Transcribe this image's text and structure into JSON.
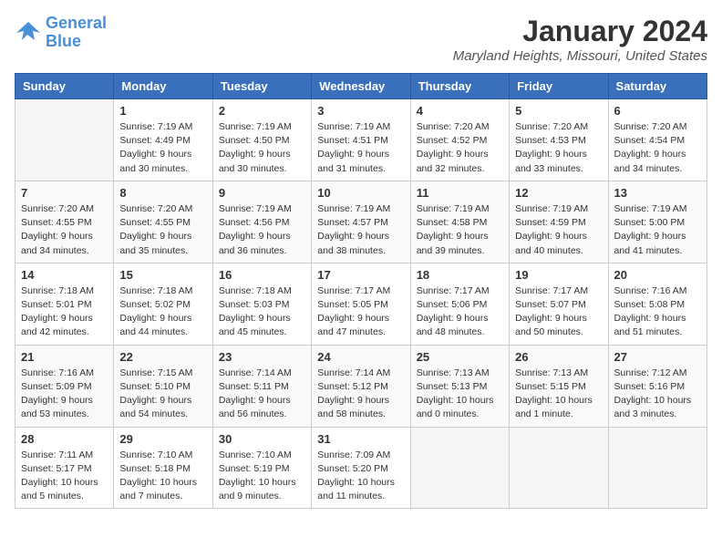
{
  "logo": {
    "line1": "General",
    "line2": "Blue"
  },
  "title": "January 2024",
  "location": "Maryland Heights, Missouri, United States",
  "headers": [
    "Sunday",
    "Monday",
    "Tuesday",
    "Wednesday",
    "Thursday",
    "Friday",
    "Saturday"
  ],
  "weeks": [
    [
      {
        "day": "",
        "info": ""
      },
      {
        "day": "1",
        "info": "Sunrise: 7:19 AM\nSunset: 4:49 PM\nDaylight: 9 hours\nand 30 minutes."
      },
      {
        "day": "2",
        "info": "Sunrise: 7:19 AM\nSunset: 4:50 PM\nDaylight: 9 hours\nand 30 minutes."
      },
      {
        "day": "3",
        "info": "Sunrise: 7:19 AM\nSunset: 4:51 PM\nDaylight: 9 hours\nand 31 minutes."
      },
      {
        "day": "4",
        "info": "Sunrise: 7:20 AM\nSunset: 4:52 PM\nDaylight: 9 hours\nand 32 minutes."
      },
      {
        "day": "5",
        "info": "Sunrise: 7:20 AM\nSunset: 4:53 PM\nDaylight: 9 hours\nand 33 minutes."
      },
      {
        "day": "6",
        "info": "Sunrise: 7:20 AM\nSunset: 4:54 PM\nDaylight: 9 hours\nand 34 minutes."
      }
    ],
    [
      {
        "day": "7",
        "info": "Sunrise: 7:20 AM\nSunset: 4:55 PM\nDaylight: 9 hours\nand 34 minutes."
      },
      {
        "day": "8",
        "info": "Sunrise: 7:20 AM\nSunset: 4:55 PM\nDaylight: 9 hours\nand 35 minutes."
      },
      {
        "day": "9",
        "info": "Sunrise: 7:19 AM\nSunset: 4:56 PM\nDaylight: 9 hours\nand 36 minutes."
      },
      {
        "day": "10",
        "info": "Sunrise: 7:19 AM\nSunset: 4:57 PM\nDaylight: 9 hours\nand 38 minutes."
      },
      {
        "day": "11",
        "info": "Sunrise: 7:19 AM\nSunset: 4:58 PM\nDaylight: 9 hours\nand 39 minutes."
      },
      {
        "day": "12",
        "info": "Sunrise: 7:19 AM\nSunset: 4:59 PM\nDaylight: 9 hours\nand 40 minutes."
      },
      {
        "day": "13",
        "info": "Sunrise: 7:19 AM\nSunset: 5:00 PM\nDaylight: 9 hours\nand 41 minutes."
      }
    ],
    [
      {
        "day": "14",
        "info": "Sunrise: 7:18 AM\nSunset: 5:01 PM\nDaylight: 9 hours\nand 42 minutes."
      },
      {
        "day": "15",
        "info": "Sunrise: 7:18 AM\nSunset: 5:02 PM\nDaylight: 9 hours\nand 44 minutes."
      },
      {
        "day": "16",
        "info": "Sunrise: 7:18 AM\nSunset: 5:03 PM\nDaylight: 9 hours\nand 45 minutes."
      },
      {
        "day": "17",
        "info": "Sunrise: 7:17 AM\nSunset: 5:05 PM\nDaylight: 9 hours\nand 47 minutes."
      },
      {
        "day": "18",
        "info": "Sunrise: 7:17 AM\nSunset: 5:06 PM\nDaylight: 9 hours\nand 48 minutes."
      },
      {
        "day": "19",
        "info": "Sunrise: 7:17 AM\nSunset: 5:07 PM\nDaylight: 9 hours\nand 50 minutes."
      },
      {
        "day": "20",
        "info": "Sunrise: 7:16 AM\nSunset: 5:08 PM\nDaylight: 9 hours\nand 51 minutes."
      }
    ],
    [
      {
        "day": "21",
        "info": "Sunrise: 7:16 AM\nSunset: 5:09 PM\nDaylight: 9 hours\nand 53 minutes."
      },
      {
        "day": "22",
        "info": "Sunrise: 7:15 AM\nSunset: 5:10 PM\nDaylight: 9 hours\nand 54 minutes."
      },
      {
        "day": "23",
        "info": "Sunrise: 7:14 AM\nSunset: 5:11 PM\nDaylight: 9 hours\nand 56 minutes."
      },
      {
        "day": "24",
        "info": "Sunrise: 7:14 AM\nSunset: 5:12 PM\nDaylight: 9 hours\nand 58 minutes."
      },
      {
        "day": "25",
        "info": "Sunrise: 7:13 AM\nSunset: 5:13 PM\nDaylight: 10 hours\nand 0 minutes."
      },
      {
        "day": "26",
        "info": "Sunrise: 7:13 AM\nSunset: 5:15 PM\nDaylight: 10 hours\nand 1 minute."
      },
      {
        "day": "27",
        "info": "Sunrise: 7:12 AM\nSunset: 5:16 PM\nDaylight: 10 hours\nand 3 minutes."
      }
    ],
    [
      {
        "day": "28",
        "info": "Sunrise: 7:11 AM\nSunset: 5:17 PM\nDaylight: 10 hours\nand 5 minutes."
      },
      {
        "day": "29",
        "info": "Sunrise: 7:10 AM\nSunset: 5:18 PM\nDaylight: 10 hours\nand 7 minutes."
      },
      {
        "day": "30",
        "info": "Sunrise: 7:10 AM\nSunset: 5:19 PM\nDaylight: 10 hours\nand 9 minutes."
      },
      {
        "day": "31",
        "info": "Sunrise: 7:09 AM\nSunset: 5:20 PM\nDaylight: 10 hours\nand 11 minutes."
      },
      {
        "day": "",
        "info": ""
      },
      {
        "day": "",
        "info": ""
      },
      {
        "day": "",
        "info": ""
      }
    ]
  ]
}
